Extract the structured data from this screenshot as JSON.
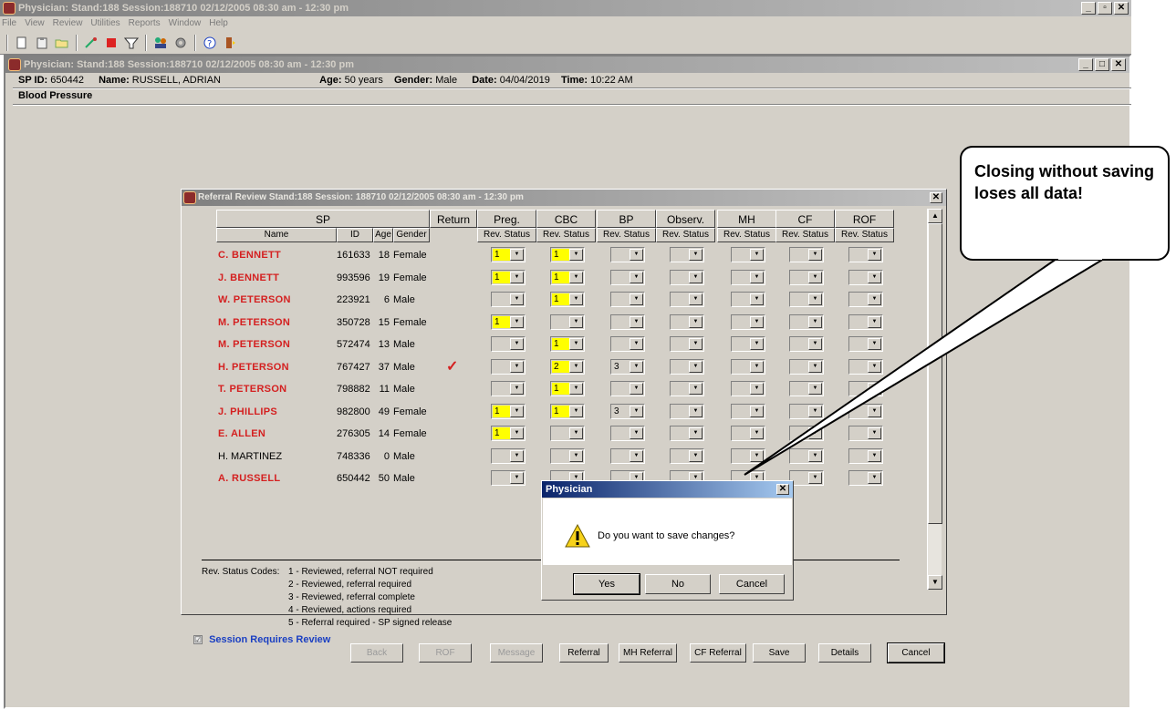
{
  "app": {
    "title": "Physician: Stand:188 Session:188710 02/12/2005 08:30 am - 12:30 pm",
    "window_controls": [
      "_",
      "▫",
      "✕"
    ]
  },
  "menu": [
    "File",
    "View",
    "Review",
    "Utilities",
    "Reports",
    "Window",
    "Help"
  ],
  "child": {
    "title": "Physician: Stand:188 Session:188710 02/12/2005 08:30 am - 12:30 pm",
    "window_controls": [
      "_",
      "□",
      "✕"
    ],
    "sp_id_label": "SP ID:",
    "sp_id": "650442",
    "name_label": "Name:",
    "name": "RUSSELL, ADRIAN",
    "age_label": "Age:",
    "age": "50 years",
    "gender_label": "Gender:",
    "gender": "Male",
    "date_label": "Date:",
    "date": "04/04/2019",
    "time_label": "Time:",
    "time": "10:22 AM",
    "section": "Blood Pressure"
  },
  "referral": {
    "title": "Referral Review Stand:188 Session: 188710 02/12/2005 08:30 am - 12:30 pm",
    "close": "✕",
    "headers_top": [
      "SP",
      "Return",
      "Preg.",
      "CBC",
      "BP",
      "Observ.",
      "MH",
      "CF",
      "ROF"
    ],
    "headers_sub": [
      "Name",
      "ID",
      "Age",
      "Gender",
      "Rev. Status"
    ],
    "rows": [
      {
        "name": "C. BENNETT",
        "id": "161633",
        "age": "18",
        "gender": "Female",
        "red": true,
        "return": "",
        "preg": "1",
        "cbc": "1",
        "bp": "",
        "observ": "",
        "mh": "",
        "cf": "",
        "rof": ""
      },
      {
        "name": "J. BENNETT",
        "id": "993596",
        "age": "19",
        "gender": "Female",
        "red": true,
        "return": "",
        "preg": "1",
        "cbc": "1",
        "bp": "",
        "observ": "",
        "mh": "",
        "cf": "",
        "rof": ""
      },
      {
        "name": "W. PETERSON",
        "id": "223921",
        "age": "6",
        "gender": "Male",
        "red": true,
        "return": "",
        "preg": "",
        "cbc": "1",
        "bp": "",
        "observ": "",
        "mh": "",
        "cf": "",
        "rof": ""
      },
      {
        "name": "M. PETERSON",
        "id": "350728",
        "age": "15",
        "gender": "Female",
        "red": true,
        "return": "",
        "preg": "1",
        "cbc": "",
        "bp": "",
        "observ": "",
        "mh": "",
        "cf": "",
        "rof": ""
      },
      {
        "name": "M. PETERSON",
        "id": "572474",
        "age": "13",
        "gender": "Male",
        "red": true,
        "return": "",
        "preg": "",
        "cbc": "1",
        "bp": "",
        "observ": "",
        "mh": "",
        "cf": "",
        "rof": ""
      },
      {
        "name": "H. PETERSON",
        "id": "767427",
        "age": "37",
        "gender": "Male",
        "red": true,
        "return": "✓",
        "preg": "",
        "cbc": "2",
        "bp": "3",
        "observ": "",
        "mh": "",
        "cf": "",
        "rof": ""
      },
      {
        "name": "T. PETERSON",
        "id": "798882",
        "age": "11",
        "gender": "Male",
        "red": true,
        "return": "",
        "preg": "",
        "cbc": "1",
        "bp": "",
        "observ": "",
        "mh": "",
        "cf": "",
        "rof": ""
      },
      {
        "name": "J. PHILLIPS",
        "id": "982800",
        "age": "49",
        "gender": "Female",
        "red": true,
        "return": "",
        "preg": "1",
        "cbc": "1",
        "bp": "3",
        "observ": "",
        "mh": "",
        "cf": "",
        "rof": ""
      },
      {
        "name": "E. ALLEN",
        "id": "276305",
        "age": "14",
        "gender": "Female",
        "red": true,
        "return": "",
        "preg": "1",
        "cbc": "",
        "bp": "",
        "observ": "",
        "mh": "",
        "cf": "",
        "rof": ""
      },
      {
        "name": "H. MARTINEZ",
        "id": "748336",
        "age": "0",
        "gender": "Male",
        "red": false,
        "return": "",
        "preg": "",
        "cbc": "",
        "bp": "",
        "observ": "",
        "mh": "",
        "cf": "",
        "rof": ""
      },
      {
        "name": "A. RUSSELL",
        "id": "650442",
        "age": "50",
        "gender": "Male",
        "red": true,
        "return": "",
        "preg": "",
        "cbc": "",
        "bp": "",
        "observ": "",
        "mh": "",
        "cf": "",
        "rof": ""
      }
    ],
    "codes_label": "Rev. Status Codes:",
    "codes": [
      "1 - Reviewed, referral NOT required",
      "2 - Reviewed, referral required",
      "3 - Reviewed, referral complete",
      "4 - Reviewed, actions required",
      "5 - Referral required - SP signed release"
    ],
    "session_review": "Session Requires Review",
    "session_review_checked": "☑",
    "buttons": [
      {
        "label": "Back",
        "enabled": false
      },
      {
        "label": "ROF",
        "enabled": false
      },
      {
        "label": "Message",
        "enabled": false
      },
      {
        "label": "Referral",
        "enabled": true
      },
      {
        "label": "MH Referral",
        "enabled": true
      },
      {
        "label": "CF Referral",
        "enabled": true
      },
      {
        "label": "Save",
        "enabled": true
      },
      {
        "label": "Details",
        "enabled": true
      },
      {
        "label": "Cancel",
        "enabled": true
      }
    ]
  },
  "dialog": {
    "title": "Physician",
    "close": "✕",
    "message": "Do you want to save changes?",
    "yes": "Yes",
    "no": "No",
    "cancel": "Cancel"
  },
  "callout": {
    "text": "Closing without saving loses all data!"
  },
  "colors": {
    "active_title": "#0a246a",
    "inactive_title": "#808080",
    "name_red": "#d42020",
    "status_yellow": "#ffff00",
    "session_review_blue": "#1a3fc2"
  }
}
